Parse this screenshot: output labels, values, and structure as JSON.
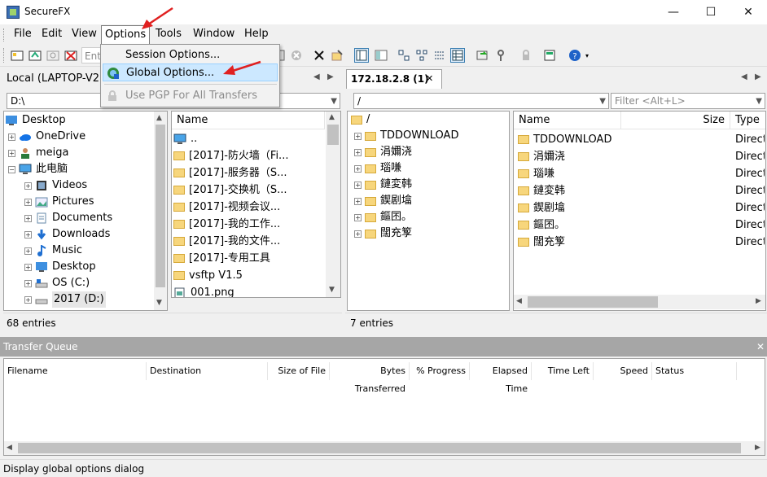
{
  "window": {
    "title": "SecureFX",
    "minimize": "—",
    "maximize": "☐",
    "close": "✕"
  },
  "menu": {
    "items": [
      "File",
      "Edit",
      "View",
      "Options",
      "Tools",
      "Window",
      "Help"
    ]
  },
  "dropdown": {
    "items": [
      {
        "label": "Session Options..."
      },
      {
        "label": "Global Options..."
      },
      {
        "label": "Use PGP For All Transfers"
      }
    ]
  },
  "toolbar": {
    "enter_placeholder": "Ente"
  },
  "local": {
    "tab": "Local (LAPTOP-V2LV",
    "path": "D:\\",
    "tree": [
      {
        "label": "Desktop"
      },
      {
        "label": "OneDrive"
      },
      {
        "label": "meiga"
      },
      {
        "label": "此电脑"
      },
      {
        "label": "Videos"
      },
      {
        "label": "Pictures"
      },
      {
        "label": "Documents"
      },
      {
        "label": "Downloads"
      },
      {
        "label": "Music"
      },
      {
        "label": "Desktop"
      },
      {
        "label": "OS (C:)"
      },
      {
        "label": "2017 (D:)"
      }
    ],
    "list_header": "Name",
    "files": [
      "..",
      "[2017]-防火墙（Fi...",
      "[2017]-服务器（S...",
      "[2017]-交换机（S...",
      "[2017]-视频会议...",
      "[2017]-我的工作...",
      "[2017]-我的文件...",
      "[2017]-专用工具",
      "vsftp V1.5",
      "001.png"
    ],
    "status": "68 entries"
  },
  "remote": {
    "tab": "172.18.2.8 (1)",
    "tab_close": "✕",
    "path": "/",
    "filter_placeholder": "Filter <Alt+L>",
    "tree_root": "/",
    "tree": [
      "TDDOWNLOAD",
      "涓嬭浇",
      "瑙嗛",
      "鏈変韩",
      "鍥剧墖",
      "鏂囨。",
      "闊充箰"
    ],
    "columns": {
      "name": "Name",
      "size": "Size",
      "type": "Type"
    },
    "files": [
      "TDDOWNLOAD",
      "涓嬭浇",
      "瑙嗛",
      "鏈変韩",
      "鍥剧墖",
      "鏂囨。",
      "闊充箰"
    ],
    "file_type": "Directo",
    "status": "7 entries"
  },
  "queue": {
    "title": "Transfer Queue",
    "close": "✕",
    "columns": [
      "Filename",
      "Destination",
      "Size of File",
      "Bytes Transferred",
      "% Progress",
      "Elapsed Time",
      "Time Left",
      "Speed",
      "Status"
    ]
  },
  "statusbar": {
    "text": "Display global options dialog"
  },
  "colors": {
    "accent": "#cce8ff",
    "arrow": "#e02020",
    "folder": "#f7d67c"
  }
}
